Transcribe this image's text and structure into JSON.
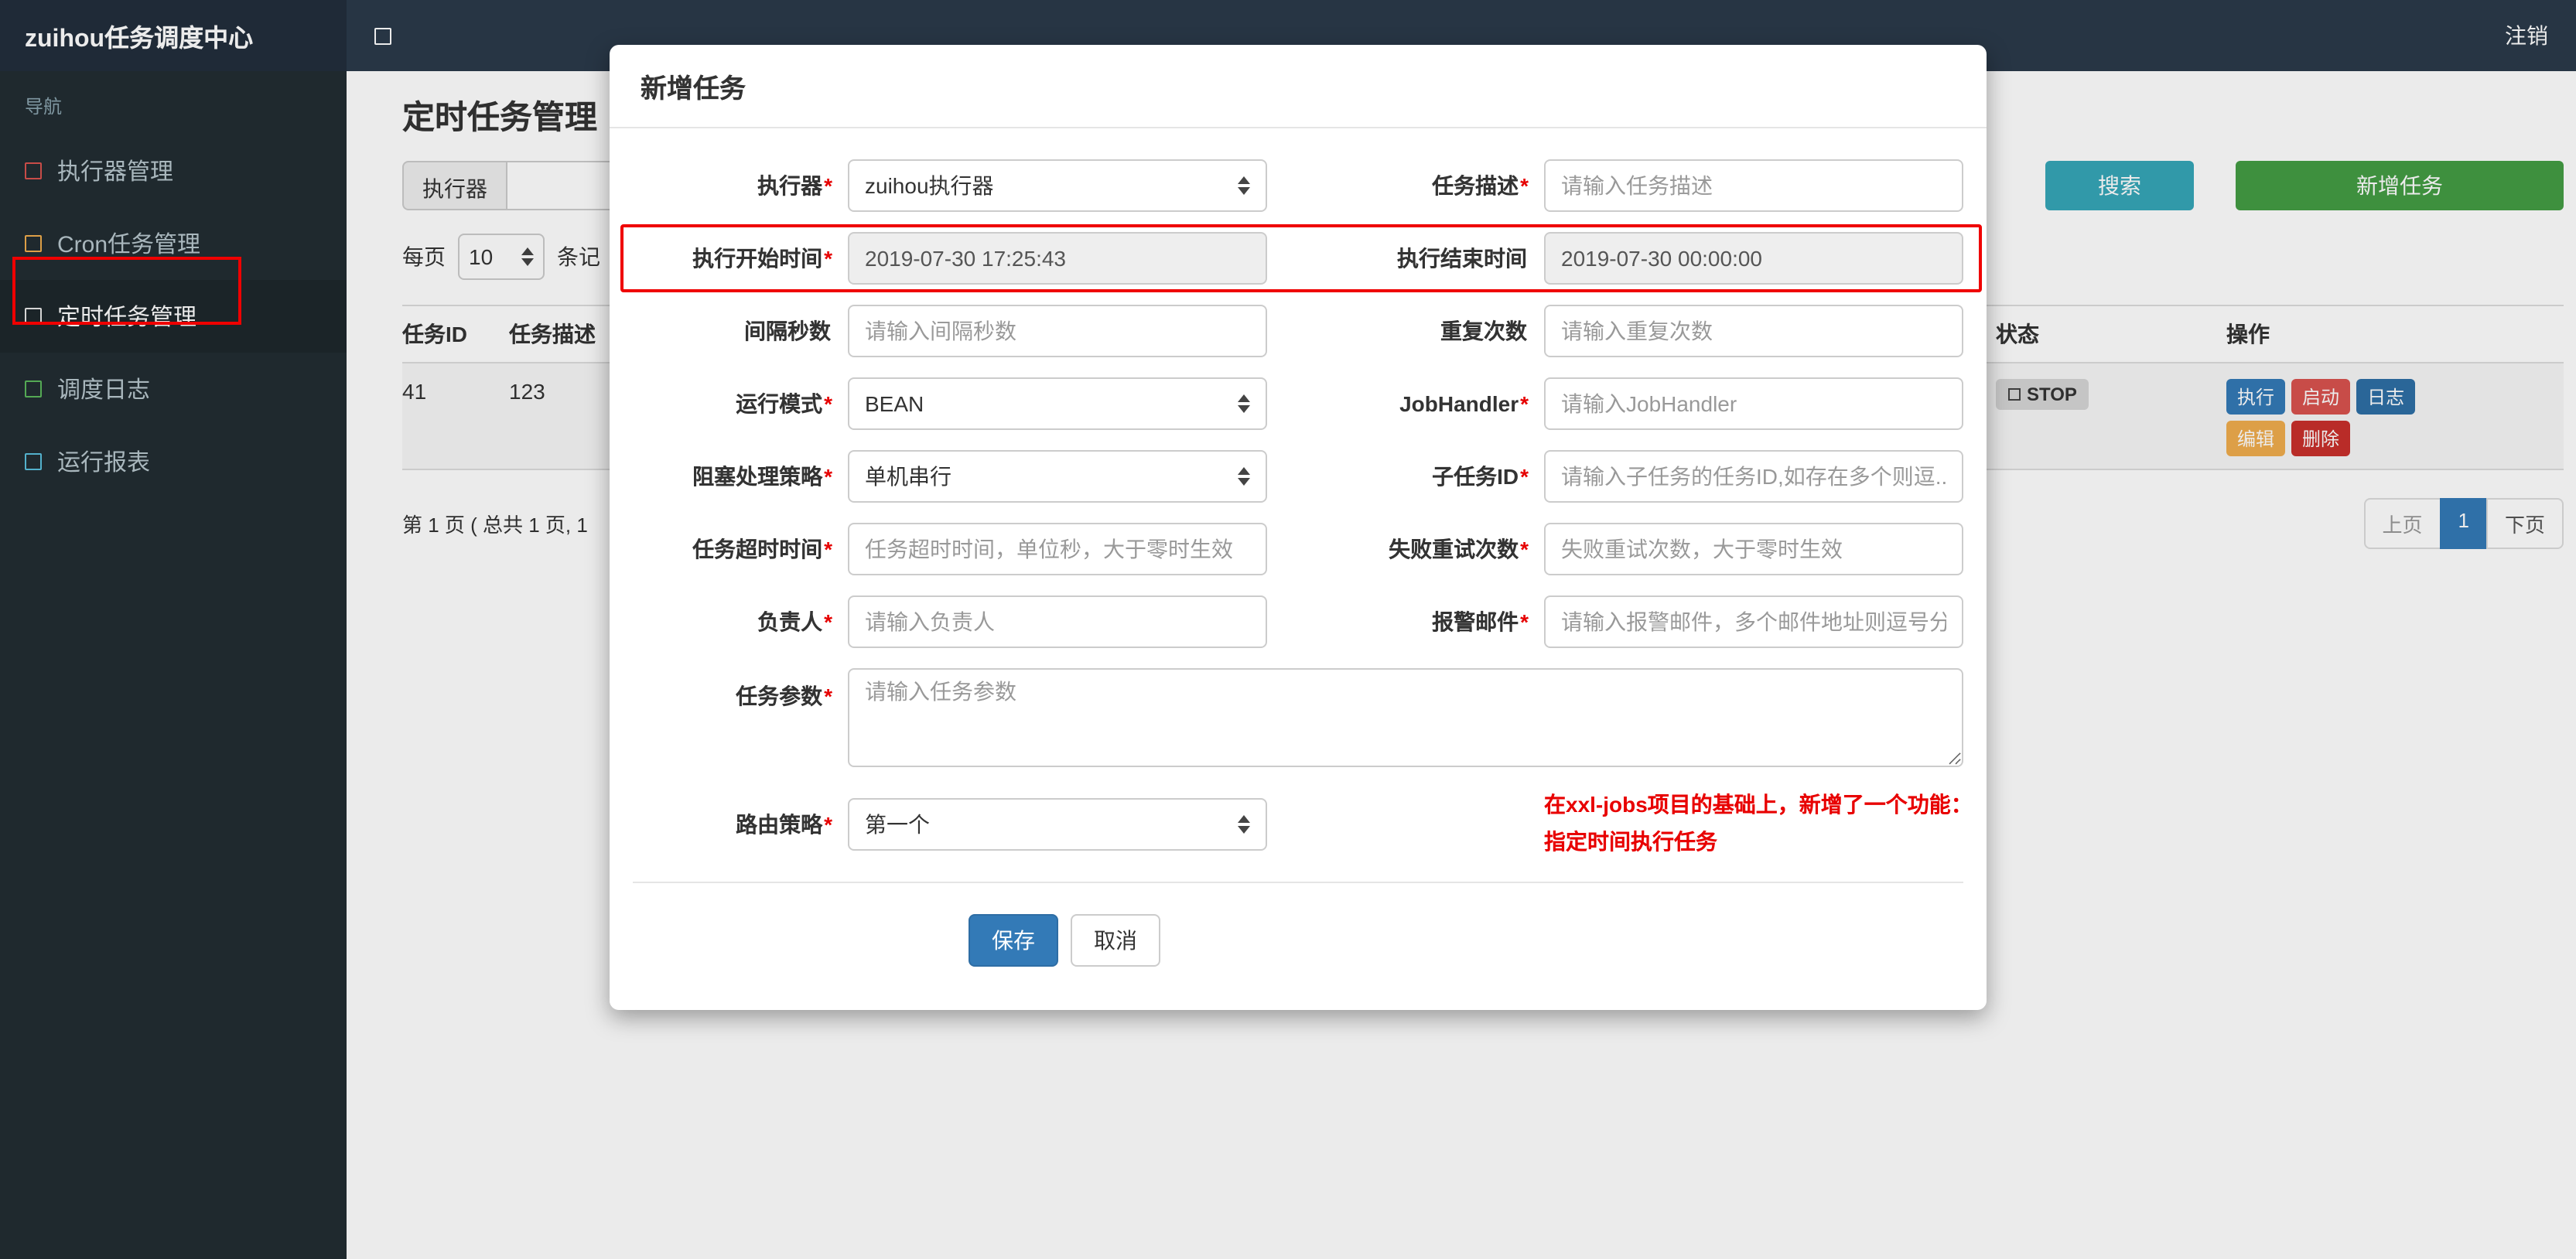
{
  "colors": {
    "navbar": "#2b3a4a",
    "sidebar": "#222d32",
    "accent_blue": "#337ab7",
    "search_teal": "#36a6b8",
    "add_green": "#449d44",
    "danger_red": "#d9534f",
    "warning_orange": "#f0ad4e",
    "annotation_red": "#ef0000"
  },
  "navbar": {
    "brand": "zuihou任务调度中心",
    "logout": "注销"
  },
  "sidebar": {
    "header": "导航",
    "items": [
      {
        "label": "执行器管理",
        "icon": "square-outline-red"
      },
      {
        "label": "Cron任务管理",
        "icon": "square-outline-orange"
      },
      {
        "label": "定时任务管理",
        "icon": "square-outline-white",
        "active": true
      },
      {
        "label": "调度日志",
        "icon": "square-outline-green"
      },
      {
        "label": "运行报表",
        "icon": "square-outline-cyan"
      }
    ]
  },
  "page": {
    "title": "定时任务管理",
    "filter": {
      "executor_addon": "执行器",
      "search": "搜索",
      "add_task": "新增任务"
    },
    "per_page": {
      "prefix": "每页",
      "value": "10",
      "suffix": "条记"
    },
    "table": {
      "headers": [
        "任务ID",
        "任务描述",
        "状态",
        "操作"
      ],
      "row": {
        "id": "41",
        "desc": "123",
        "status": "STOP",
        "actions": [
          "执行",
          "启动",
          "日志",
          "编辑",
          "删除"
        ]
      }
    },
    "pagination": {
      "info": "第 1 页 ( 总共 1 页, 1",
      "prev": "上页",
      "current": "1",
      "next": "下页"
    }
  },
  "modal": {
    "title": "新增任务",
    "executor": {
      "label": "执行器",
      "req": "*",
      "value": "zuihou执行器"
    },
    "job_desc": {
      "label": "任务描述",
      "req": "*",
      "placeholder": "请输入任务描述"
    },
    "start_time": {
      "label": "执行开始时间",
      "req": "*",
      "value": "2019-07-30 17:25:43"
    },
    "end_time": {
      "label": "执行结束时间",
      "req": "",
      "value": "2019-07-30 00:00:00"
    },
    "interval": {
      "label": "间隔秒数",
      "req": "",
      "placeholder": "请输入间隔秒数"
    },
    "repeat": {
      "label": "重复次数",
      "req": "",
      "placeholder": "请输入重复次数"
    },
    "run_mode": {
      "label": "运行模式",
      "req": "*",
      "value": "BEAN"
    },
    "job_handler": {
      "label": "JobHandler",
      "req": "*",
      "placeholder": "请输入JobHandler"
    },
    "block_strategy": {
      "label": "阻塞处理策略",
      "req": "*",
      "value": "单机串行"
    },
    "child_job": {
      "label": "子任务ID",
      "req": "*",
      "placeholder": "请输入子任务的任务ID,如存在多个则逗..."
    },
    "timeout": {
      "label": "任务超时时间",
      "req": "*",
      "placeholder": "任务超时时间，单位秒，大于零时生效"
    },
    "retry": {
      "label": "失败重试次数",
      "req": "*",
      "placeholder": "失败重试次数，大于零时生效"
    },
    "owner": {
      "label": "负责人",
      "req": "*",
      "placeholder": "请输入负责人"
    },
    "alarm_email": {
      "label": "报警邮件",
      "req": "*",
      "placeholder": "请输入报警邮件，多个邮件地址则逗号分..."
    },
    "job_param": {
      "label": "任务参数",
      "req": "*",
      "placeholder": "请输入任务参数"
    },
    "route_strategy": {
      "label": "路由策略",
      "req": "*",
      "value": "第一个"
    },
    "note_line1": "在xxl-jobs项目的基础上，新增了一个功能：",
    "note_line2": "指定时间执行任务",
    "save": "保存",
    "cancel": "取消"
  }
}
